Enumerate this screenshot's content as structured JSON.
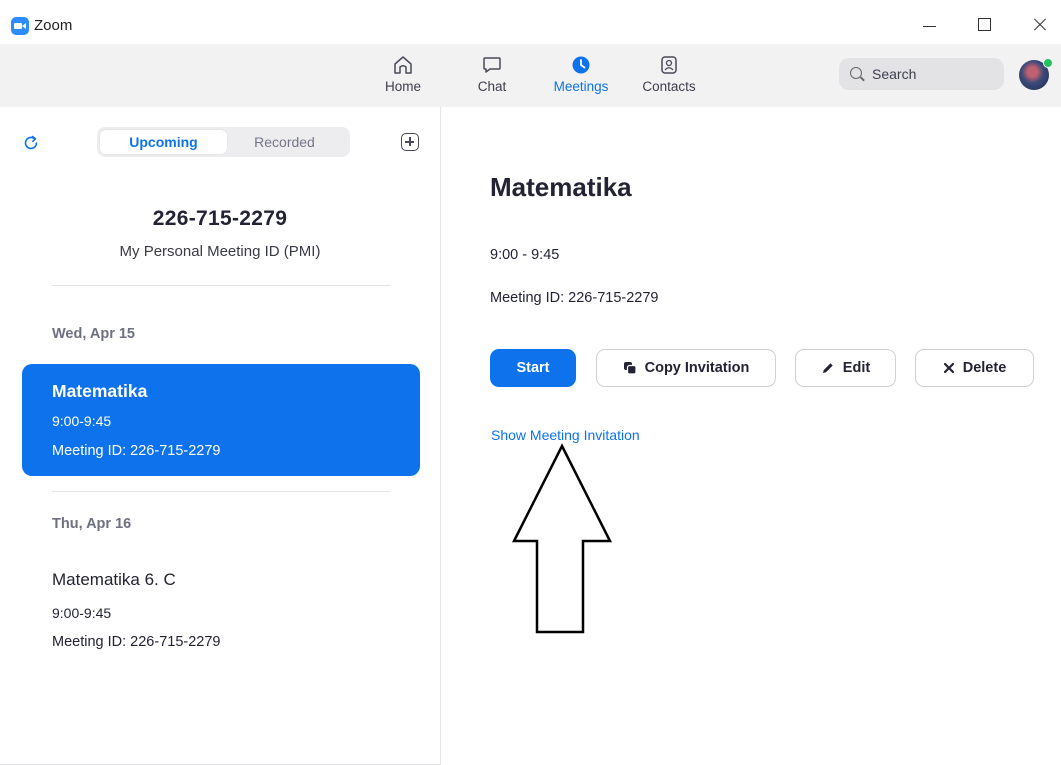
{
  "window": {
    "title": "Zoom"
  },
  "nav": {
    "items": [
      {
        "label": "Home",
        "icon": "home-icon",
        "active": false
      },
      {
        "label": "Chat",
        "icon": "chat-bubble-icon",
        "active": false
      },
      {
        "label": "Meetings",
        "icon": "clock-icon",
        "active": true
      },
      {
        "label": "Contacts",
        "icon": "contact-card-icon",
        "active": false
      }
    ],
    "search_placeholder": "Search"
  },
  "colors": {
    "accent": "#0E72ED",
    "status_online": "#22C35E"
  },
  "sidebar": {
    "tabs": {
      "upcoming": "Upcoming",
      "recorded": "Recorded"
    },
    "pmi_number": "226-715-2279",
    "pmi_label": "My Personal Meeting ID (PMI)",
    "groups": [
      {
        "date": "Wed, Apr 15",
        "meeting": {
          "title": "Matematika",
          "time": "9:00-9:45",
          "meeting_id": "Meeting ID: 226-715-2279",
          "selected": true
        }
      },
      {
        "date": "Thu, Apr 16",
        "meeting": {
          "title": "Matematika 6. C",
          "time": "9:00-9:45",
          "meeting_id": "Meeting ID: 226-715-2279",
          "selected": false
        }
      }
    ]
  },
  "detail": {
    "title": "Matematika",
    "time": "9:00 - 9:45",
    "meeting_id": "Meeting ID: 226-715-2279",
    "buttons": {
      "start": "Start",
      "copy_invitation": "Copy Invitation",
      "edit": "Edit",
      "delete": "Delete"
    },
    "show_invitation_link": "Show Meeting Invitation"
  }
}
